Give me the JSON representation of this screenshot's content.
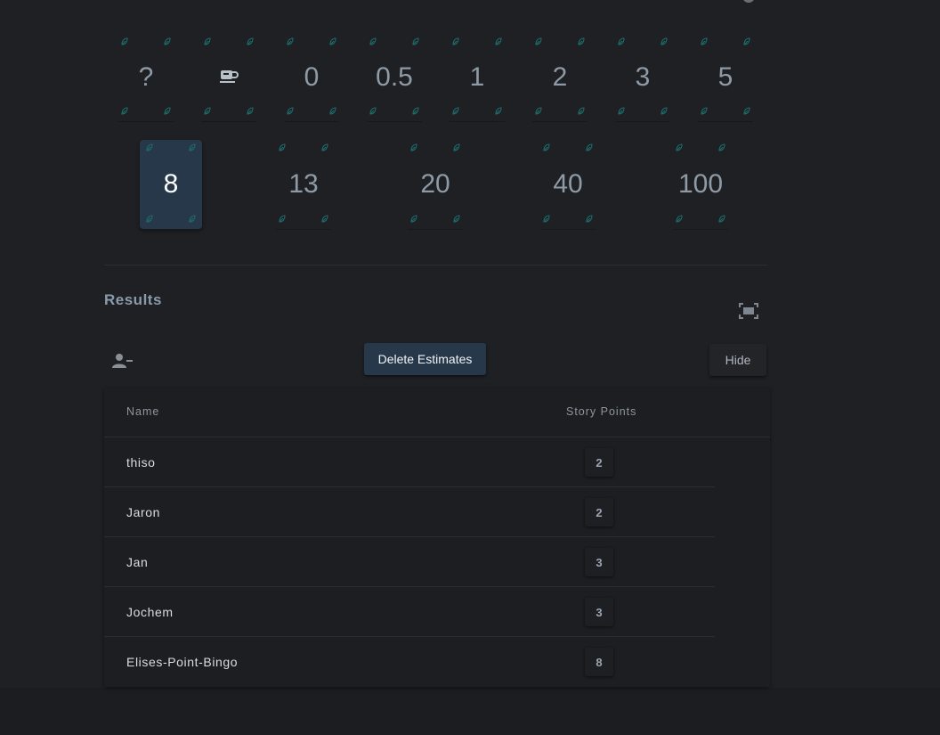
{
  "cards_row1": [
    "?",
    "coffee",
    "0",
    "0.5",
    "1",
    "2",
    "3",
    "5"
  ],
  "cards_row2": [
    "8",
    "13",
    "20",
    "40",
    "100"
  ],
  "selected_card": "8",
  "results": {
    "title": "Results",
    "delete_label": "Delete Estimates",
    "hide_label": "Hide",
    "columns": [
      "Name",
      "Story Points"
    ],
    "rows": [
      {
        "name": "thiso",
        "points": "2"
      },
      {
        "name": "Jaron",
        "points": "2"
      },
      {
        "name": "Jan",
        "points": "3"
      },
      {
        "name": "Jochem",
        "points": "3"
      },
      {
        "name": "Elises-Point-Bingo",
        "points": "8"
      }
    ]
  },
  "icons": {
    "settings": "gear-icon",
    "coffee": "coffee-cup-icon",
    "card_corner": "leaf-icon",
    "fullscreen": "fullscreen-icon",
    "remove_user": "remove-user-icon"
  },
  "colors": {
    "background": "#1f2023",
    "selected_card": "#26384a",
    "card_text": "#8e9aa6",
    "corner_icon": "#1e5e5e"
  }
}
